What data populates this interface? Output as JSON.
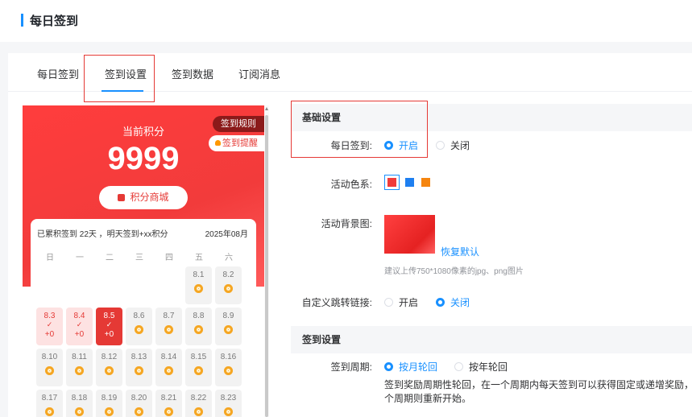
{
  "header": {
    "title": "每日签到"
  },
  "tabs": [
    "每日签到",
    "签到设置",
    "签到数据",
    "订阅消息"
  ],
  "preview": {
    "points_label": "当前积分",
    "points": "9999",
    "mall_button": "积分商城",
    "rule_button": "签到规则",
    "remind_button": "签到提醒",
    "summary": "已累积签到 22天 ，明天签到+xx积分",
    "month": "2025年08月",
    "weekdays": [
      "日",
      "一",
      "二",
      "三",
      "四",
      "五",
      "六"
    ],
    "days": [
      {
        "label": "8.1",
        "state": "normal"
      },
      {
        "label": "8.2",
        "state": "normal"
      },
      {
        "label": "8.3",
        "state": "signed",
        "check": "✓",
        "reward": "+0"
      },
      {
        "label": "8.4",
        "state": "signed",
        "check": "✓",
        "reward": "+0"
      },
      {
        "label": "8.5",
        "state": "today",
        "check": "✓",
        "reward": "+0"
      },
      {
        "label": "8.6",
        "state": "normal"
      },
      {
        "label": "8.7",
        "state": "normal"
      },
      {
        "label": "8.8",
        "state": "normal"
      },
      {
        "label": "8.9",
        "state": "normal"
      },
      {
        "label": "8.10",
        "state": "normal"
      },
      {
        "label": "8.11",
        "state": "normal"
      },
      {
        "label": "8.12",
        "state": "normal"
      },
      {
        "label": "8.13",
        "state": "normal"
      },
      {
        "label": "8.14",
        "state": "normal"
      },
      {
        "label": "8.15",
        "state": "normal"
      },
      {
        "label": "8.16",
        "state": "normal"
      },
      {
        "label": "8.17",
        "state": "normal"
      },
      {
        "label": "8.18",
        "state": "normal"
      },
      {
        "label": "8.19",
        "state": "normal"
      },
      {
        "label": "8.20",
        "state": "normal"
      },
      {
        "label": "8.21",
        "state": "normal"
      },
      {
        "label": "8.22",
        "state": "normal"
      },
      {
        "label": "8.23",
        "state": "normal"
      }
    ]
  },
  "basic": {
    "section_title": "基础设置",
    "daily_label": "每日签到:",
    "on_label": "开启",
    "off_label": "关闭",
    "color_label": "活动色系:",
    "colors": [
      "#f03b3b",
      "#1e7ff0",
      "#f5850f"
    ],
    "bg_label": "活动背景图:",
    "restore_link": "恢复默认",
    "upload_hint": "建议上传750*1080像素的jpg、png图片",
    "jump_label": "自定义跳转链接:",
    "jump_on": "开启",
    "jump_off": "关闭"
  },
  "signin": {
    "section_title": "签到设置",
    "cycle_label": "签到周期:",
    "monthly": "按月轮回",
    "yearly": "按年轮回",
    "desc_line1": "签到奖励周期性轮回，在一个周期内每天签到可以获得固定或递增奖励，当一个",
    "desc_line2": "个周期则重新开始。"
  }
}
